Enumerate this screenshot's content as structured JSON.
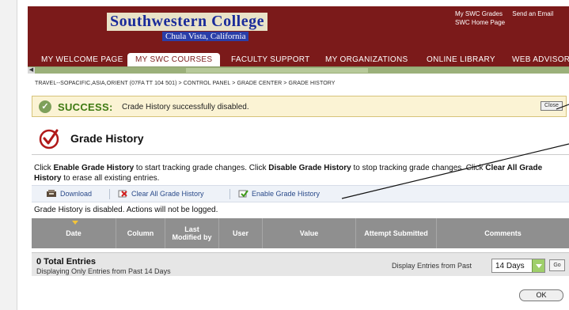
{
  "header": {
    "logo_title": "Southwestern College",
    "logo_subtitle": "Chula Vista, California",
    "top_links": [
      "My SWC Grades",
      "Send an Email",
      "SWC Home Page"
    ]
  },
  "nav": {
    "tabs": [
      {
        "label": "MY WELCOME PAGE",
        "active": false
      },
      {
        "label": "MY SWC COURSES",
        "active": true
      },
      {
        "label": "FACULTY SUPPORT",
        "active": false
      },
      {
        "label": "MY ORGANIZATIONS",
        "active": false
      },
      {
        "label": "ONLINE LIBRARY",
        "active": false
      },
      {
        "label": "WEB ADVISOR",
        "active": false
      }
    ]
  },
  "breadcrumb": "TRAVEL--SOPACIFIC,ASIA,ORIENT (07FA TT 104 501) > CONTROL PANEL > GRADE CENTER > GRADE HISTORY",
  "success": {
    "word": "SUCCESS:",
    "message": "Crade History successfully disabled.",
    "close_label": "Close"
  },
  "page": {
    "title": "Grade History",
    "instructions": {
      "p1": "Click ",
      "b1": "Enable Grade History",
      "p2": " to start tracking grade changes. Click ",
      "b2": "Disable Grade History",
      "p3": " to stop tracking grade changes. Click ",
      "b3": "Clear All Grade History",
      "p4": " to erase all existing entries."
    },
    "disabled_note": "Grade History is disabled. Actions will not be logged."
  },
  "actions": [
    {
      "label": "Download",
      "icon": "download-icon"
    },
    {
      "label": "Clear All Grade History",
      "icon": "clear-icon"
    },
    {
      "label": "Enable Grade History",
      "icon": "enable-icon"
    }
  ],
  "table": {
    "columns": [
      "Date",
      "Column",
      "Last Modified by",
      "User",
      "Value",
      "Attempt Submitted",
      "Comments"
    ]
  },
  "footer": {
    "total": "0 Total Entries",
    "displaying": "Displaying Only Entries from Past 14 Days",
    "display_label": "Display Entries from Past",
    "days_value": "14 Days",
    "go_label": "Go"
  },
  "ok_label": "OK",
  "colors": {
    "brand": "#7b1a1a",
    "success_text": "#3e7a12",
    "table_header": "#8f8f8f"
  }
}
